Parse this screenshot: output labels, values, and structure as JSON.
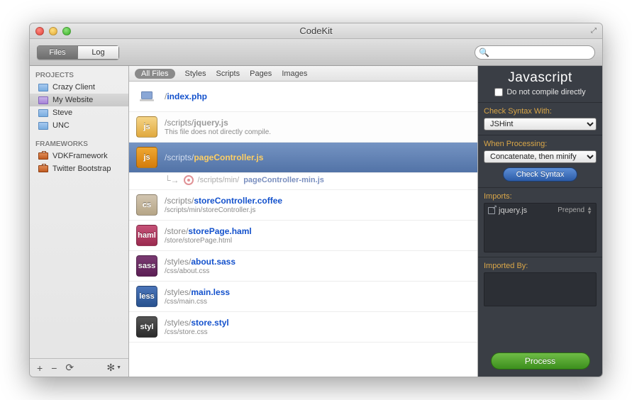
{
  "title": "CodeKit",
  "toolbar": {
    "tab_files": "Files",
    "tab_log": "Log",
    "search_placeholder": ""
  },
  "sidebar": {
    "heading_projects": "PROJECTS",
    "heading_frameworks": "FRAMEWORKS",
    "projects": [
      {
        "label": "Crazy Client"
      },
      {
        "label": "My Website"
      },
      {
        "label": "Steve"
      },
      {
        "label": "UNC"
      }
    ],
    "frameworks": [
      {
        "label": "VDKFramework"
      },
      {
        "label": "Twitter Bootstrap"
      }
    ]
  },
  "filters": {
    "all": "All Files",
    "styles": "Styles",
    "scripts": "Scripts",
    "pages": "Pages",
    "images": "Images"
  },
  "files": {
    "index": {
      "dir": "/",
      "name": "index.php"
    },
    "jquery": {
      "dir": "/scripts/",
      "name": "jquery.js",
      "sub": "This file does not directly compile."
    },
    "pagectrl": {
      "dir": "/scripts/",
      "name": "pageController.js"
    },
    "pagectrl_out": {
      "dir": "/scripts/min/",
      "name": "pageController-min.js"
    },
    "storectrl": {
      "dir": "/scripts/",
      "name": "storeController.coffee",
      "sub": "/scripts/min/storeController.js"
    },
    "storepage": {
      "dir": "/store/",
      "name": "storePage.haml",
      "sub": "/store/storePage.html"
    },
    "about": {
      "dir": "/styles/",
      "name": "about.sass",
      "sub": "/css/about.css"
    },
    "main": {
      "dir": "/styles/",
      "name": "main.less",
      "sub": "/css/main.css"
    },
    "store": {
      "dir": "/styles/",
      "name": "store.styl",
      "sub": "/css/store.css"
    },
    "badge_js": "js",
    "badge_cs": "cs",
    "badge_haml": "haml",
    "badge_sass": "sass",
    "badge_less": "less",
    "badge_styl": "styl"
  },
  "inspector": {
    "title": "Javascript",
    "compile_directly": "Do not compile directly",
    "check_syntax_label": "Check Syntax With:",
    "check_syntax_value": "JSHint",
    "when_processing_label": "When Processing:",
    "when_processing_value": "Concatenate, then minify",
    "check_syntax_btn": "Check Syntax",
    "imports_label": "Imports:",
    "import_item": "jquery.js",
    "import_mode": "Prepend",
    "imported_by_label": "Imported By:",
    "process_btn": "Process"
  }
}
